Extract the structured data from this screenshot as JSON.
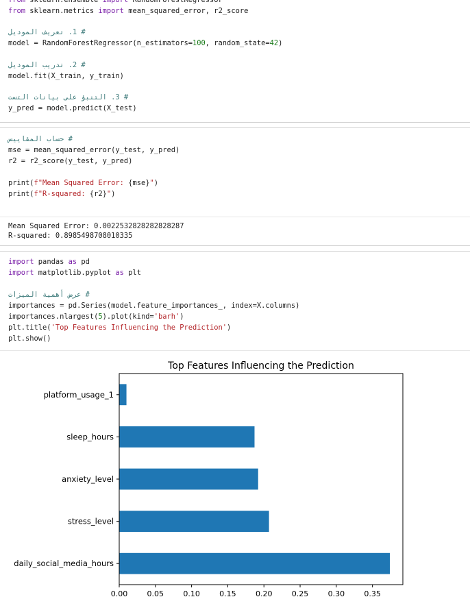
{
  "cell1": {
    "lines": [
      [
        [
          "kw",
          "from"
        ],
        [
          "t",
          " sklearn.ensemble "
        ],
        [
          "kw",
          "import"
        ],
        [
          "t",
          " RandomForestRegressor"
        ]
      ],
      [
        [
          "kw",
          "from"
        ],
        [
          "t",
          " sklearn.metrics "
        ],
        [
          "kw",
          "import"
        ],
        [
          "t",
          " mean_squared_error, r2_score"
        ]
      ],
      [],
      [
        [
          "cm",
          "# 1. تعريف الموديل"
        ]
      ],
      [
        [
          "t",
          "model = RandomForestRegressor(n_estimators="
        ],
        [
          "num",
          "100"
        ],
        [
          "t",
          ", random_state="
        ],
        [
          "num",
          "42"
        ],
        [
          "t",
          ")"
        ]
      ],
      [],
      [
        [
          "cm",
          "# 2. تدريب الموديل"
        ]
      ],
      [
        [
          "t",
          "model.fit(X_train, y_train)"
        ]
      ],
      [],
      [
        [
          "cm",
          "# 3. التنبؤ على بيانات التست"
        ]
      ],
      [
        [
          "t",
          "y_pred = model.predict(X_test)"
        ]
      ]
    ]
  },
  "cell2": {
    "lines": [
      [
        [
          "cm",
          "# حساب المقاييس"
        ]
      ],
      [
        [
          "t",
          "mse = mean_squared_error(y_test, y_pred)"
        ]
      ],
      [
        [
          "t",
          "r2 = r2_score(y_test, y_pred)"
        ]
      ],
      [],
      [
        [
          "t",
          "print("
        ],
        [
          "str",
          "f\"Mean Squared Error: "
        ],
        [
          "t",
          "{mse}"
        ],
        [
          "str",
          "\""
        ],
        [
          "t",
          ")"
        ]
      ],
      [
        [
          "t",
          "print("
        ],
        [
          "str",
          "f\"R-squared: "
        ],
        [
          "t",
          "{r2}"
        ],
        [
          "str",
          "\""
        ],
        [
          "t",
          ")"
        ]
      ]
    ],
    "output": [
      "Mean Squared Error: 0.0022532828282828287",
      "R-squared: 0.8985498708010335"
    ]
  },
  "cell3": {
    "lines": [
      [
        [
          "kw",
          "import"
        ],
        [
          "t",
          " pandas "
        ],
        [
          "kw",
          "as"
        ],
        [
          "t",
          " pd"
        ]
      ],
      [
        [
          "kw",
          "import"
        ],
        [
          "t",
          " matplotlib.pyplot "
        ],
        [
          "kw",
          "as"
        ],
        [
          "t",
          " plt"
        ]
      ],
      [],
      [
        [
          "cm",
          "# عرض أهمية الميزات"
        ]
      ],
      [
        [
          "t",
          "importances = pd.Series(model.feature_importances_, index=X.columns)"
        ]
      ],
      [
        [
          "t",
          "importances.nlargest("
        ],
        [
          "num",
          "5"
        ],
        [
          "t",
          ").plot(kind="
        ],
        [
          "str",
          "'barh'"
        ],
        [
          "t",
          ")"
        ]
      ],
      [
        [
          "t",
          "plt.title("
        ],
        [
          "str",
          "'Top Features Influencing the Prediction'"
        ],
        [
          "t",
          ")"
        ]
      ],
      [
        [
          "t",
          "plt.show()"
        ]
      ]
    ]
  },
  "colors": {
    "bar": "#1f77b4",
    "keyword": "#7a1fa8",
    "comment": "#3d7a7a",
    "string": "#b4262a",
    "number": "#1a7a1a"
  },
  "chart_data": {
    "type": "bar",
    "orientation": "horizontal",
    "title": "Top Features Influencing the Prediction",
    "categories": [
      "daily_social_media_hours",
      "stress_level",
      "anxiety_level",
      "sleep_hours",
      "platform_usage_1"
    ],
    "values": [
      0.374,
      0.207,
      0.192,
      0.187,
      0.01
    ],
    "xlim": [
      0,
      0.392
    ],
    "xticks": [
      "0.00",
      "0.05",
      "0.10",
      "0.15",
      "0.20",
      "0.25",
      "0.30",
      "0.35"
    ],
    "xlabel": "",
    "ylabel": "",
    "grid": false
  }
}
